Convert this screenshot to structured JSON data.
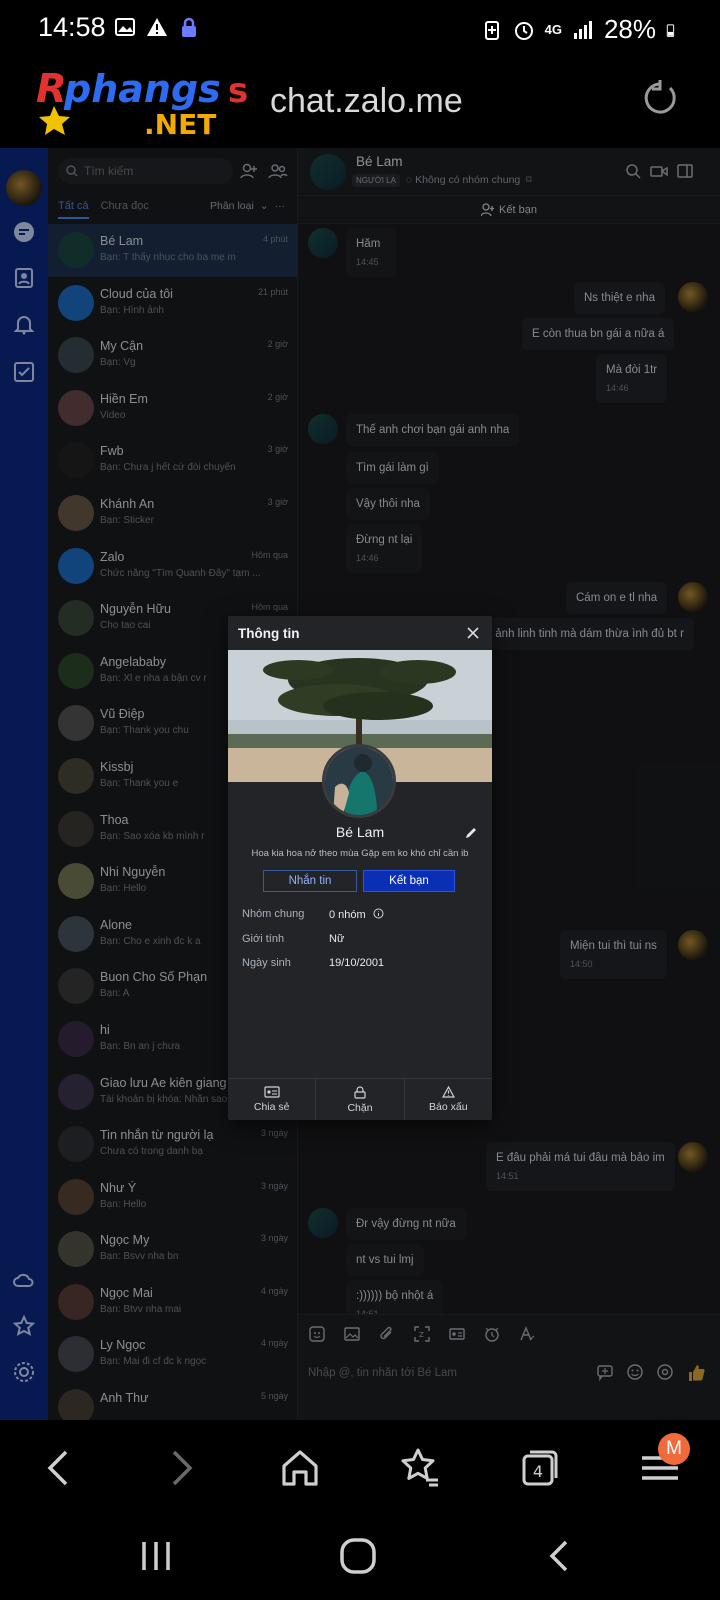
{
  "status": {
    "time": "14:58",
    "network": "4G",
    "battery": "28%",
    "left_icons": [
      "image-icon",
      "warning-icon",
      "lock-icon"
    ],
    "right_icons": [
      "battery-saver-icon",
      "alarm-icon",
      "signal-icon",
      "battery-icon"
    ]
  },
  "browser": {
    "logo_text": "Rphangs",
    "logo_suffix": ".NET",
    "url": "chat.zalo.me",
    "tab_count": "4",
    "profile_letter": "M"
  },
  "sidebar_nav": {
    "icons": [
      "avatar",
      "chat-icon",
      "contacts-icon",
      "bell-icon",
      "todo-icon",
      "cloud-icon",
      "star-icon",
      "settings-icon"
    ]
  },
  "list": {
    "search_placeholder": "Tìm kiếm",
    "tab_all": "Tất cả",
    "tab_unread": "Chưa đọc",
    "classify": "Phân loại",
    "conversations": [
      {
        "name": "Bé Lam",
        "preview": "Bạn: T thấy nhục cho ba mẹ m",
        "time": "4 phút"
      },
      {
        "name": "Cloud của tôi",
        "preview": "Bạn: Hình ảnh",
        "time": "21 phút"
      },
      {
        "name": "My Cận",
        "preview": "Bạn: Vg",
        "time": "2 giờ"
      },
      {
        "name": "Hiền Em",
        "preview": "Video",
        "time": "2 giờ"
      },
      {
        "name": "Fwb",
        "preview": "Bạn: Chưa j hết cứ đòi chuyển",
        "time": "3 giờ"
      },
      {
        "name": "Khánh An",
        "preview": "Bạn: Sticker",
        "time": "3 giờ"
      },
      {
        "name": "Zalo",
        "preview": "Chức năng \"Tìm Quanh Đây\" tạm ...",
        "time": "Hôm qua"
      },
      {
        "name": "Nguyễn Hữu",
        "preview": "Cho tao cai",
        "time": "Hôm qua"
      },
      {
        "name": "Angelababy",
        "preview": "Bạn: Xl e nha a bận cv r",
        "time": ""
      },
      {
        "name": "Vũ Điệp",
        "preview": "Bạn: Thank you chu",
        "time": ""
      },
      {
        "name": "Kissbj",
        "preview": "Bạn: Thank you e",
        "time": ""
      },
      {
        "name": "Thoa",
        "preview": "Bạn: Sao xóa kb mình r",
        "time": ""
      },
      {
        "name": "Nhi Nguyễn",
        "preview": "Bạn: Hello",
        "time": ""
      },
      {
        "name": "Alone",
        "preview": "Bạn: Cho e xinh đc k a",
        "time": ""
      },
      {
        "name": "Buon Cho Số Phạn",
        "preview": "Bạn: A",
        "time": ""
      },
      {
        "name": "hi",
        "preview": "Bạn: Bn an j chưa",
        "time": ""
      },
      {
        "name": "Giao lưu Ae kiên giang",
        "preview": "Tài khoản bị khóa: Nhắn sao",
        "time": ""
      },
      {
        "name": "Tin nhắn từ người lạ",
        "preview": "Chưa có trong danh bạ",
        "time": "3 ngày"
      },
      {
        "name": "Như Ý",
        "preview": "Bạn: Hello",
        "time": "3 ngày"
      },
      {
        "name": "Ngọc My",
        "preview": "Bạn: Bsvv nha bn",
        "time": "3 ngày"
      },
      {
        "name": "Ngọc Mai",
        "preview": "Bạn: Btvv nha mai",
        "time": "4 ngày"
      },
      {
        "name": "Ly Ngọc",
        "preview": "Bạn: Mai đi cf đc k ngọc",
        "time": "4 ngày"
      },
      {
        "name": "Anh Thư",
        "preview": "",
        "time": "5 ngày"
      }
    ],
    "vu_diep_sub": "Vũ Điệp"
  },
  "chat": {
    "name": "Bé Lam",
    "tag": "NGƯỜI LẠ",
    "group_text": "Không có nhóm chung",
    "add_friend": "Kết bạn",
    "messages": [
      {
        "side": "in",
        "text": "Hăm",
        "time": "14:45"
      },
      {
        "side": "out",
        "text": "Ns thiệt e nha",
        "time": ""
      },
      {
        "side": "out",
        "text": "E còn thua bn gái a nữa á",
        "time": ""
      },
      {
        "side": "out",
        "text": "Mà đòi 1tr",
        "time": "14:46"
      },
      {
        "side": "in",
        "text": "Thế anh chơi bạn gái anh nha",
        "time": ""
      },
      {
        "side": "in",
        "text": "Tìm gái làm gì",
        "time": ""
      },
      {
        "side": "in",
        "text": "Vậy thôi nha",
        "time": ""
      },
      {
        "side": "in",
        "text": "Đừng nt lại",
        "time": "14:46"
      },
      {
        "side": "out",
        "text": "Cám on e tl nha",
        "time": ""
      },
      {
        "side": "out",
        "text": "ưa ảnh linh tinh mà dám thừa ình đủ bt r",
        "time": ""
      },
      {
        "side": "out",
        "text": "Miện tui thì tui ns",
        "time": "14:50"
      },
      {
        "side": "in",
        "text": "",
        "time": "14:51"
      },
      {
        "side": "out",
        "text": "E đâu phải má tui đâu mà bảo im",
        "time": "14:51"
      },
      {
        "side": "in",
        "text": "Đr vậy đừng nt nữa",
        "time": ""
      },
      {
        "side": "in",
        "text": "nt vs tui lmj",
        "time": ""
      },
      {
        "side": "in",
        "text": ":)))))) bộ nhột á",
        "time": "14:51"
      }
    ],
    "input_placeholder": "Nhập @, tin nhắn tới Bé Lam"
  },
  "modal": {
    "title": "Thông tin",
    "name": "Bé Lam",
    "bio": "Hoa kia hoa nở theo mùa Gặp em ko khó chỉ cần ib",
    "btn_message": "Nhắn tin",
    "btn_add": "Kết bạn",
    "rows": [
      {
        "label": "Nhóm chung",
        "value": "0 nhóm"
      },
      {
        "label": "Giới tính",
        "value": "Nữ"
      },
      {
        "label": "Ngày sinh",
        "value": "19/10/2001"
      }
    ],
    "footer": [
      {
        "label": "Chia sẻ",
        "icon": "share-card-icon"
      },
      {
        "label": "Chặn",
        "icon": "lock-icon"
      },
      {
        "label": "Báo xấu",
        "icon": "warning-icon"
      }
    ]
  },
  "colors": {
    "nav_blue": "#0b2a83",
    "accent": "#4a8bf0",
    "primary_button": "#0a2fb5",
    "badge": "#f06a3c"
  }
}
